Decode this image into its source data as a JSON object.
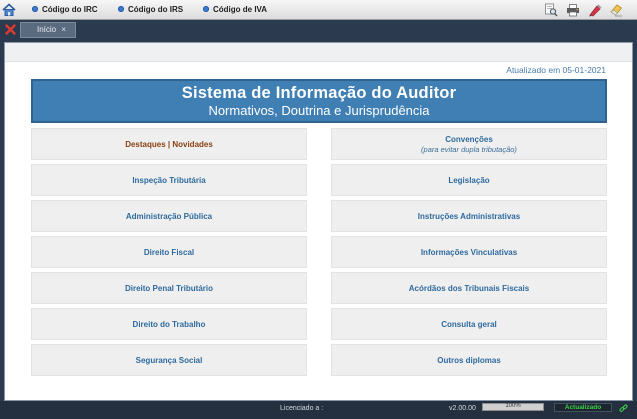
{
  "topbar": {
    "links": [
      {
        "label": "Código do IRC"
      },
      {
        "label": "Código do IRS"
      },
      {
        "label": "Código de IVA"
      }
    ],
    "tools": [
      "search-doc-icon",
      "print-icon",
      "highlighter-icon",
      "eraser-icon"
    ]
  },
  "tabbar": {
    "tab_label": "Início",
    "tab_close": "×"
  },
  "content": {
    "updated": "Atualizado em 05-01-2021",
    "banner_title": "Sistema de Informação do Auditor",
    "banner_subtitle": "Normativos, Doutrina e Jurisprudência",
    "left_buttons": [
      {
        "part1": "Destaques",
        "sep": " | ",
        "part2": "Novidades"
      },
      {
        "label": "Inspeção Tributária"
      },
      {
        "label": "Administração Pública"
      },
      {
        "label": "Direito Fiscal"
      },
      {
        "label": "Direito Penal Tributário"
      },
      {
        "label": "Direito do Trabalho"
      },
      {
        "label": "Segurança Social"
      }
    ],
    "right_buttons": [
      {
        "label": "Convenções",
        "sub": "(para evitar dupla tributação)"
      },
      {
        "label": "Legislação"
      },
      {
        "label": "Instruções Administrativas"
      },
      {
        "label": "Informações Vinculativas"
      },
      {
        "label": "Acórdãos dos Tribunais Fiscais"
      },
      {
        "label": "Consulta geral"
      },
      {
        "label": "Outros diplomas"
      }
    ]
  },
  "status": {
    "licensed": "Licenciado a :",
    "version": "v2.00.00",
    "progress_label": "100%",
    "progress_fraction": 1.0,
    "state": "Actualizado"
  },
  "colors": {
    "banner": "#3f7fb4",
    "button_text": "#2e6a9e",
    "highlight_text": "#8a3f10",
    "status_green": "#3fd14a"
  }
}
